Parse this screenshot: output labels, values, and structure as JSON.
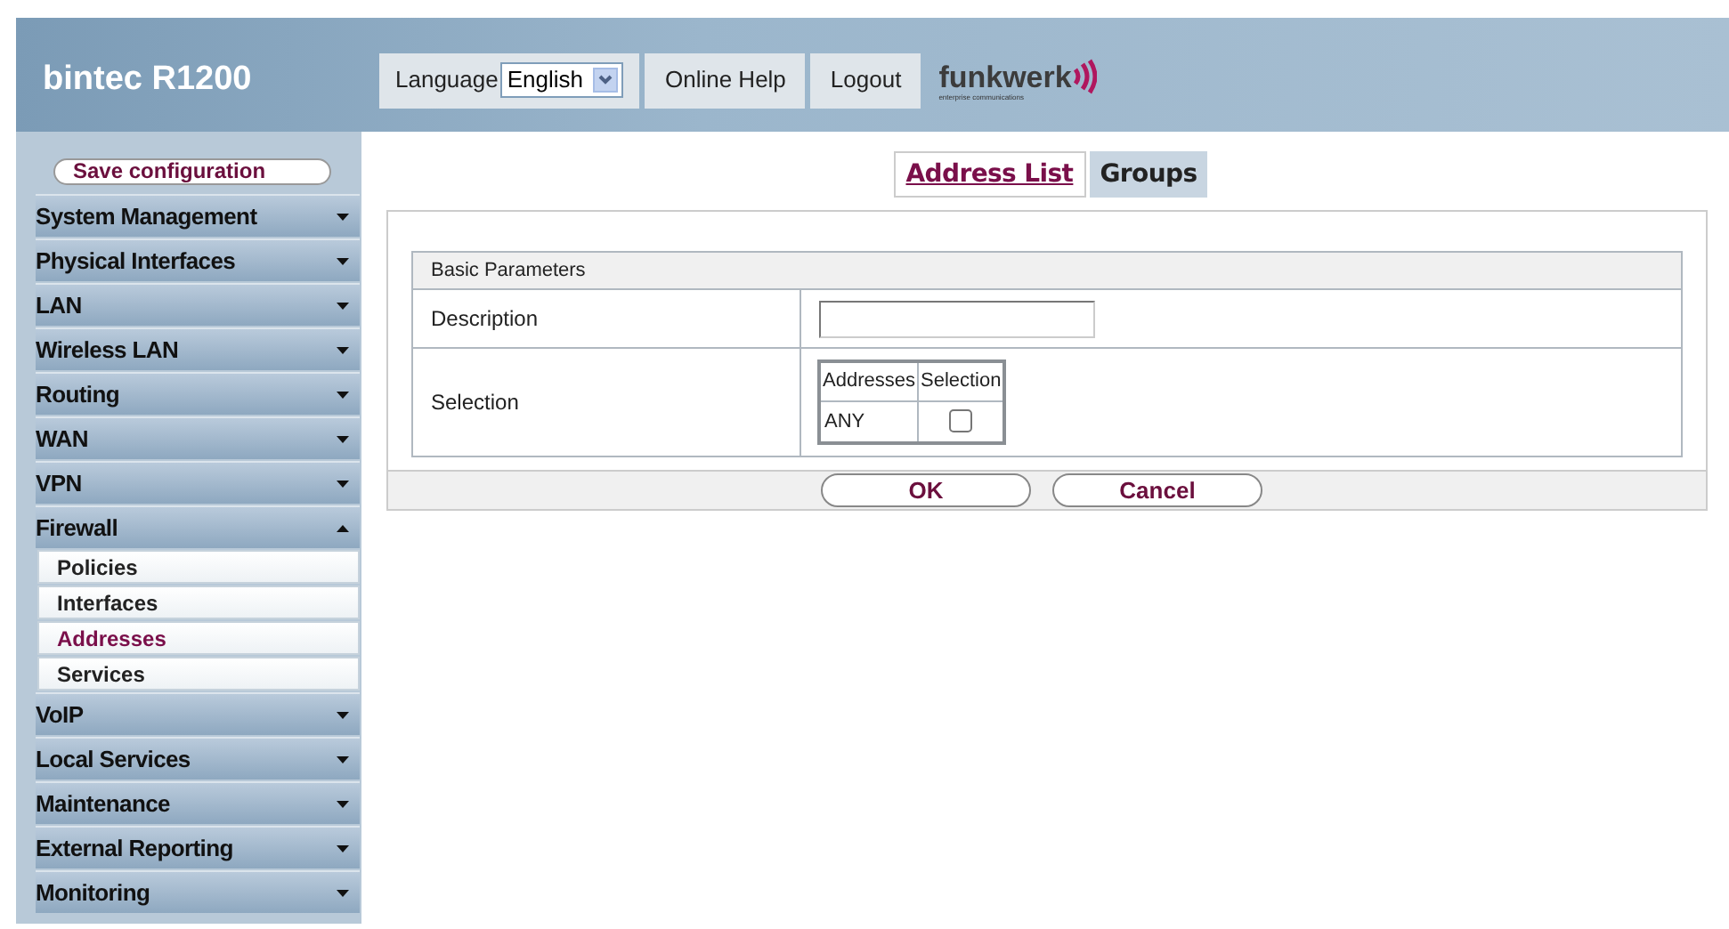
{
  "header": {
    "product": "bintec R1200",
    "language_label": "Language",
    "language_value": "English",
    "links": [
      "Online Help",
      "Logout"
    ],
    "logo": {
      "name": "funkwerk",
      "tagline": "enterprise communications"
    }
  },
  "sidebar": {
    "save_button": "Save configuration",
    "items": [
      {
        "label": "System Management",
        "expanded": false
      },
      {
        "label": "Physical Interfaces",
        "expanded": false
      },
      {
        "label": "LAN",
        "expanded": false
      },
      {
        "label": "Wireless LAN",
        "expanded": false
      },
      {
        "label": "Routing",
        "expanded": false
      },
      {
        "label": "WAN",
        "expanded": false
      },
      {
        "label": "VPN",
        "expanded": false
      },
      {
        "label": "Firewall",
        "expanded": true,
        "children": [
          {
            "label": "Policies",
            "selected": false
          },
          {
            "label": "Interfaces",
            "selected": false
          },
          {
            "label": "Addresses",
            "selected": true
          },
          {
            "label": "Services",
            "selected": false
          }
        ]
      },
      {
        "label": "VoIP",
        "expanded": false
      },
      {
        "label": "Local Services",
        "expanded": false
      },
      {
        "label": "Maintenance",
        "expanded": false
      },
      {
        "label": "External Reporting",
        "expanded": false
      },
      {
        "label": "Monitoring",
        "expanded": false
      }
    ]
  },
  "tabs": [
    {
      "label": "Address List",
      "selected": true
    },
    {
      "label": "Groups",
      "selected": false
    }
  ],
  "form": {
    "section": "Basic Parameters",
    "description": {
      "label": "Description"
    },
    "selection": {
      "label": "Selection",
      "columns": [
        "Addresses",
        "Selection"
      ],
      "rows": [
        {
          "address": "ANY",
          "checked": false
        }
      ]
    },
    "buttons": [
      "OK",
      "Cancel"
    ]
  }
}
